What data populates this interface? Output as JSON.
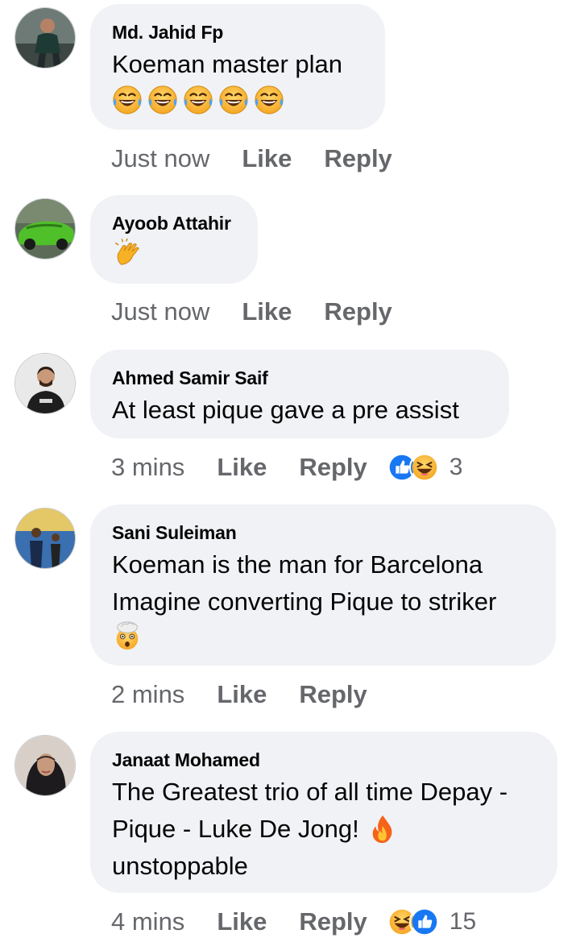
{
  "comments": [
    {
      "name": "Md. Jahid Fp",
      "text": "Koeman master plan",
      "emoji_line": [
        "laughing-tears",
        "laughing-tears",
        "laughing-tears",
        "laughing-tears",
        "laughing-tears"
      ],
      "time": "Just now",
      "like_label": "Like",
      "reply_label": "Reply"
    },
    {
      "name": "Ayoob Attahir",
      "emoji_line": [
        "clapping-hands"
      ],
      "time": "Just now",
      "like_label": "Like",
      "reply_label": "Reply"
    },
    {
      "name": "Ahmed Samir Saif",
      "text": "At least pique gave a pre assist",
      "time": "3 mins",
      "like_label": "Like",
      "reply_label": "Reply",
      "reactions": [
        "like",
        "haha"
      ],
      "reaction_count": "3"
    },
    {
      "name": "Sani Suleiman",
      "text_lines": [
        "Koeman is the man for Barcelona",
        "Imagine converting Pique to striker"
      ],
      "emoji_line": [
        "exploding-head"
      ],
      "time": "2 mins",
      "like_label": "Like",
      "reply_label": "Reply"
    },
    {
      "name": "Janaat Mohamed",
      "text_lines": [
        "The Greatest trio of all time Depay -",
        "Pique - Luke De Jong!",
        "unstoppable"
      ],
      "inline_emoji": "fire",
      "time": "4 mins",
      "like_label": "Like",
      "reply_label": "Reply",
      "reactions": [
        "haha",
        "like"
      ],
      "reaction_count": "15"
    }
  ],
  "colors": {
    "bubble": "#f0f2f5",
    "meta": "#65676b",
    "text": "#050505",
    "like_blue": "#1877f2",
    "haha_yellow": "#f7b125"
  }
}
